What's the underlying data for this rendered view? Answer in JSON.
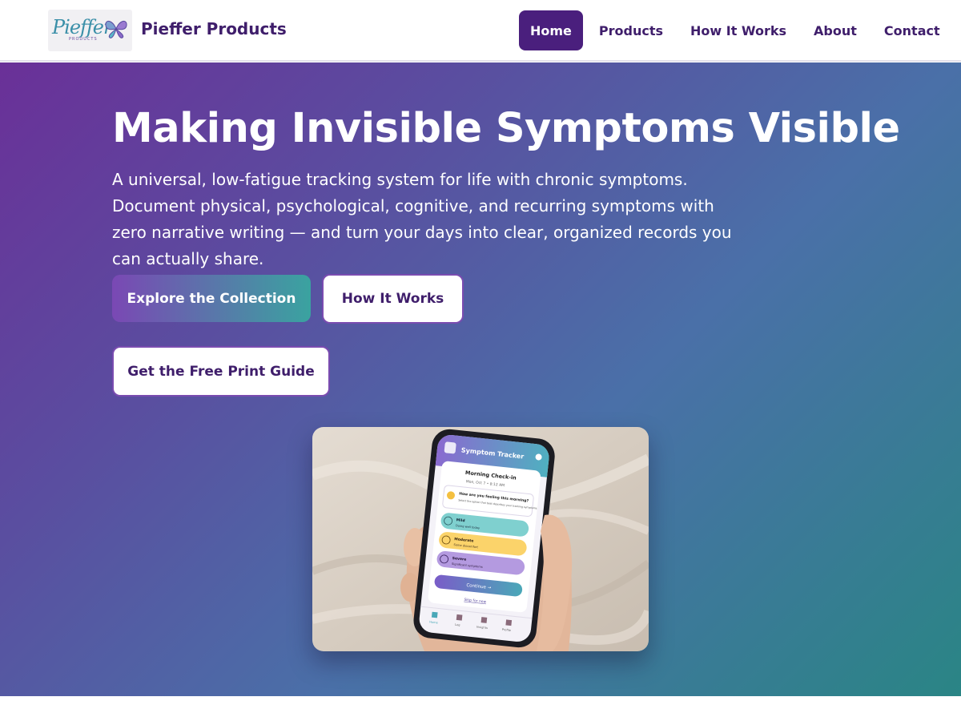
{
  "brand": {
    "logo_text": "Pieffer",
    "logo_subtext": "PRODUCTS",
    "name": "Pieffer Products"
  },
  "nav": {
    "items": [
      {
        "label": "Home",
        "active": true
      },
      {
        "label": "Products",
        "active": false
      },
      {
        "label": "How It Works",
        "active": false
      },
      {
        "label": "About",
        "active": false
      },
      {
        "label": "Contact",
        "active": false
      }
    ]
  },
  "hero": {
    "title": "Making Invisible Symptoms Visible",
    "description": "A universal, low-fatigue tracking system for life with chronic symptoms. Document physical, psychological, cognitive, and recurring symptoms with zero narrative writing — and turn your days into clear, organized records you can actually share.",
    "primary_button": "Explore the Collection",
    "secondary_button": "How It Works",
    "guide_button": "Get the Free Print Guide"
  },
  "phone": {
    "app_title": "Symptom Tracker",
    "card_title": "Morning Check-in",
    "card_date": "Mon, Oct 7 • 8:12 AM",
    "question": "How are you feeling this morning?",
    "question_sub": "Select the option that best describes your tracking symptoms",
    "options": [
      {
        "label": "Mild",
        "sub": "Doing well today"
      },
      {
        "label": "Moderate",
        "sub": "Some discomfort"
      },
      {
        "label": "Severe",
        "sub": "Significant symptoms"
      }
    ],
    "continue_label": "Continue →",
    "skip_label": "Skip for now",
    "tabs": [
      "Home",
      "Log",
      "Insights",
      "Profile"
    ]
  },
  "colors": {
    "brand_purple": "#4a1f7d",
    "gradient_start": "#6a3098",
    "gradient_end": "#2a8585"
  }
}
